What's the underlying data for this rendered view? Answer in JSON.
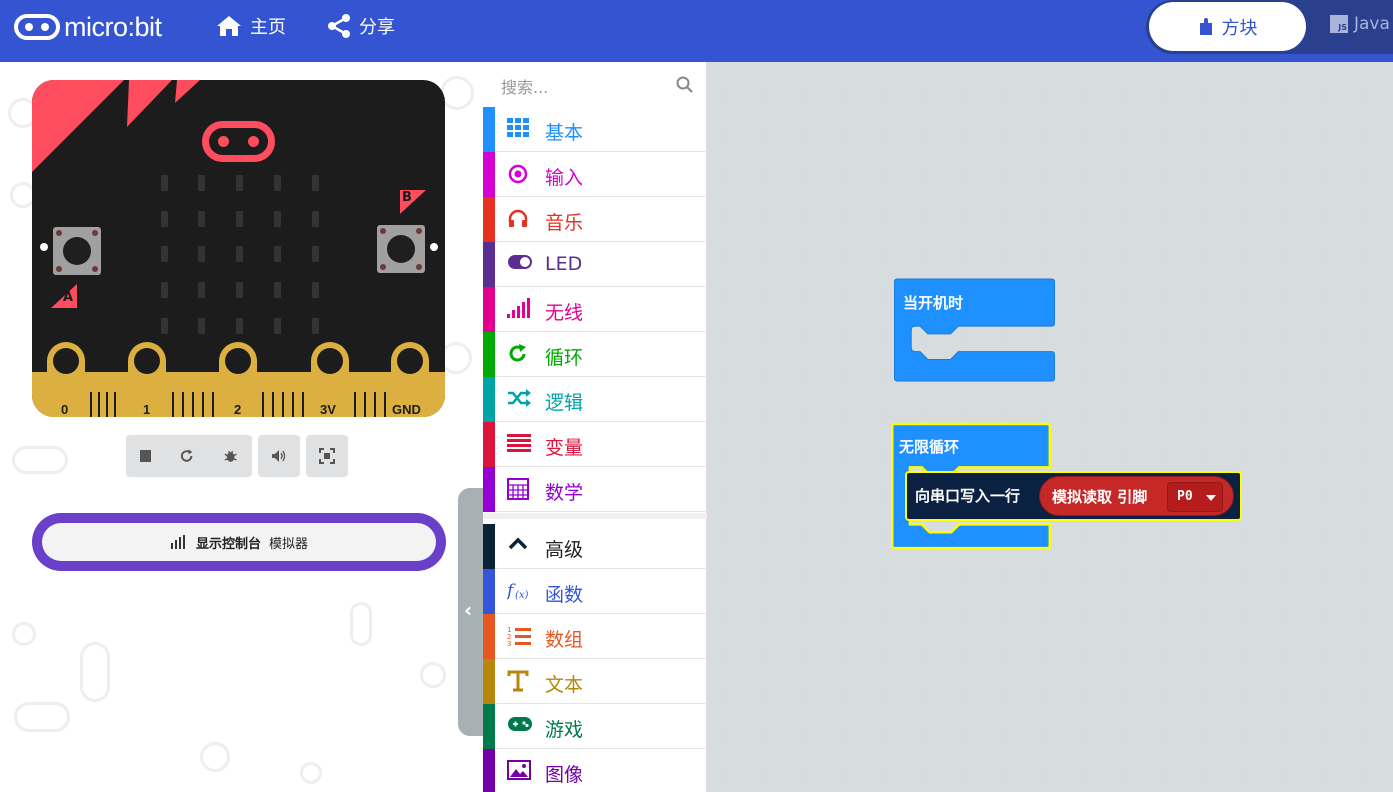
{
  "header": {
    "logo_text": "micro:bit",
    "nav": [
      {
        "label": "主页",
        "icon": "home-icon"
      },
      {
        "label": "分享",
        "icon": "share-icon"
      }
    ],
    "editor_tabs": [
      {
        "label": "方块",
        "icon": "puzzle-icon",
        "active": true
      },
      {
        "label": "Java",
        "icon": "js-icon",
        "badge": "JS",
        "active": false
      }
    ],
    "colors": {
      "brand": "#3454d1",
      "toggle_bg": "#2a3f8d"
    }
  },
  "simulator": {
    "button_a": "A",
    "button_b": "B",
    "pins": [
      "0",
      "1",
      "2",
      "3V",
      "GND"
    ],
    "toolbar": [
      {
        "icon": "stop-icon"
      },
      {
        "icon": "restart-icon"
      },
      {
        "icon": "debug-icon"
      },
      {
        "icon": "sound-icon"
      },
      {
        "icon": "fullscreen-icon"
      }
    ],
    "console_button": {
      "bold": "显示控制台",
      "label": "模拟器",
      "icon": "bar-chart-icon"
    }
  },
  "toolbox": {
    "search_placeholder": "搜索...",
    "categories": [
      {
        "label": "基本",
        "color": "#1e90ff",
        "icon": "grid-icon"
      },
      {
        "label": "输入",
        "color": "#d400d4",
        "icon": "radio-target-icon"
      },
      {
        "label": "音乐",
        "color": "#e63022",
        "icon": "headphones-icon"
      },
      {
        "label": "LED",
        "color": "#5c2d91",
        "icon": "toggle-icon"
      },
      {
        "label": "无线",
        "color": "#e3008c",
        "icon": "signal-icon"
      },
      {
        "label": "循环",
        "color": "#00aa00",
        "icon": "refresh-icon"
      },
      {
        "label": "逻辑",
        "color": "#00a4a6",
        "icon": "shuffle-icon"
      },
      {
        "label": "变量",
        "color": "#dc143c",
        "icon": "list-lines-icon"
      },
      {
        "label": "数学",
        "color": "#9400d3",
        "icon": "calculator-icon"
      }
    ],
    "advanced": [
      {
        "label": "高级",
        "color": "#0a2339",
        "icon": "chevron-up-icon"
      },
      {
        "label": "函数",
        "color": "#3455db",
        "icon": "function-icon"
      },
      {
        "label": "数组",
        "color": "#e65722",
        "icon": "ordered-list-icon"
      },
      {
        "label": "文本",
        "color": "#b8860b",
        "icon": "text-icon"
      },
      {
        "label": "游戏",
        "color": "#007a4b",
        "icon": "gamepad-icon"
      },
      {
        "label": "图像",
        "color": "#7600a8",
        "icon": "image-icon"
      }
    ]
  },
  "workspace": {
    "on_start": "当开机时",
    "forever": "无限循环",
    "serial_write_line": "向串口写入一行",
    "analog_read": "模拟读取 引脚",
    "pin_value": "P0"
  }
}
